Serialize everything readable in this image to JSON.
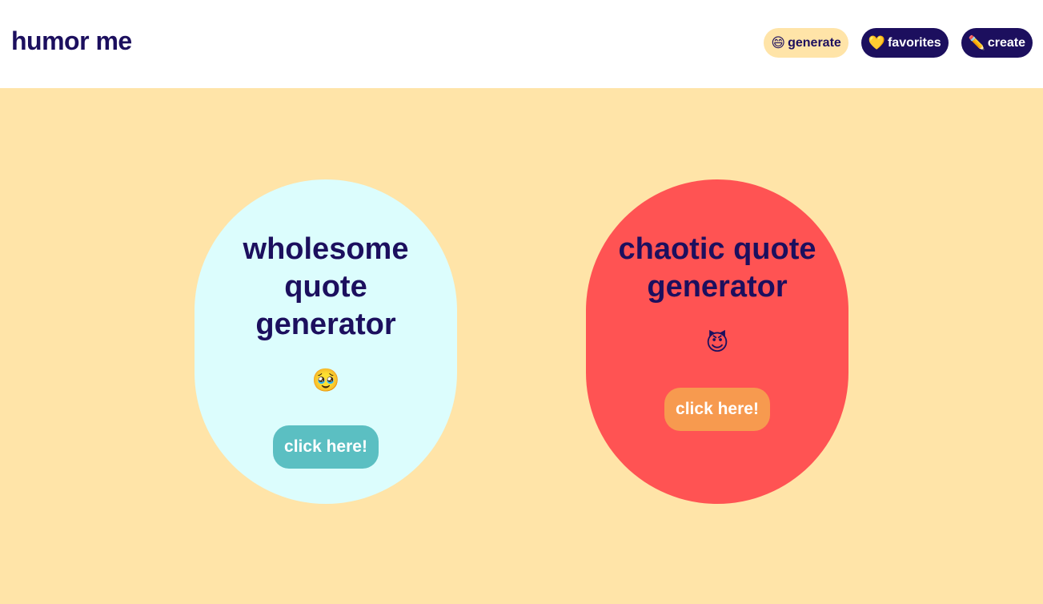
{
  "header": {
    "brand": "humor me",
    "nav": [
      {
        "emoji": "😄",
        "label": "generate",
        "icon": "grinning-face-icon"
      },
      {
        "emoji": "💛",
        "label": "favorites",
        "icon": "yellow-heart-icon"
      },
      {
        "emoji": "✏️",
        "label": "create",
        "icon": "pencil-icon"
      }
    ]
  },
  "cards": {
    "wholesome": {
      "title": "wholesome quote generator",
      "emoji": "🥹",
      "button_label": "click here!"
    },
    "chaotic": {
      "title": "chaotic quote generator",
      "emoji": "😈",
      "button_label": "click here!"
    }
  },
  "colors": {
    "brand_navy": "#1c0f5e",
    "page_background": "#ffe4a8",
    "wholesome_card": "#dcfdfd",
    "wholesome_button": "#5bbfc2",
    "chaotic_card": "#ff5353",
    "chaotic_button": "#f79a4f"
  }
}
